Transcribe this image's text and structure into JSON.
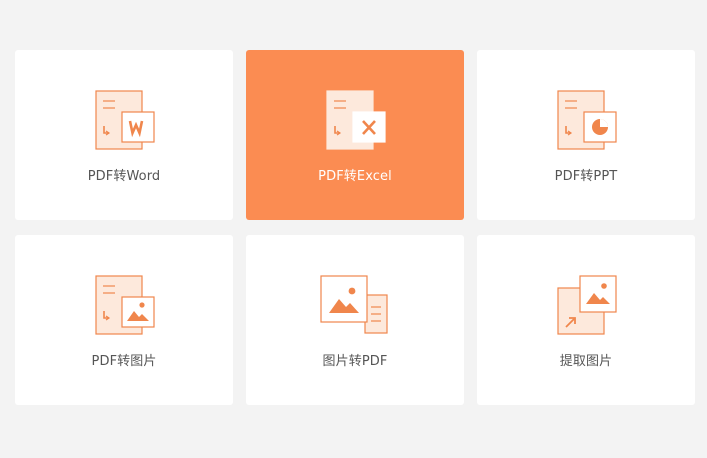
{
  "tools": [
    {
      "label": "PDF转Word",
      "icon": "pdf-to-word-icon",
      "active": false
    },
    {
      "label": "PDF转Excel",
      "icon": "pdf-to-excel-icon",
      "active": true
    },
    {
      "label": "PDF转PPT",
      "icon": "pdf-to-ppt-icon",
      "active": false
    },
    {
      "label": "PDF转图片",
      "icon": "pdf-to-image-icon",
      "active": false
    },
    {
      "label": "图片转PDF",
      "icon": "image-to-pdf-icon",
      "active": false
    },
    {
      "label": "提取图片",
      "icon": "extract-image-icon",
      "active": false
    }
  ],
  "colors": {
    "accent": "#fb8c52",
    "icon_stroke": "#f0864c",
    "icon_fill": "#fde9dc",
    "label": "#555555",
    "background": "#f3f3f3",
    "card": "#ffffff"
  }
}
